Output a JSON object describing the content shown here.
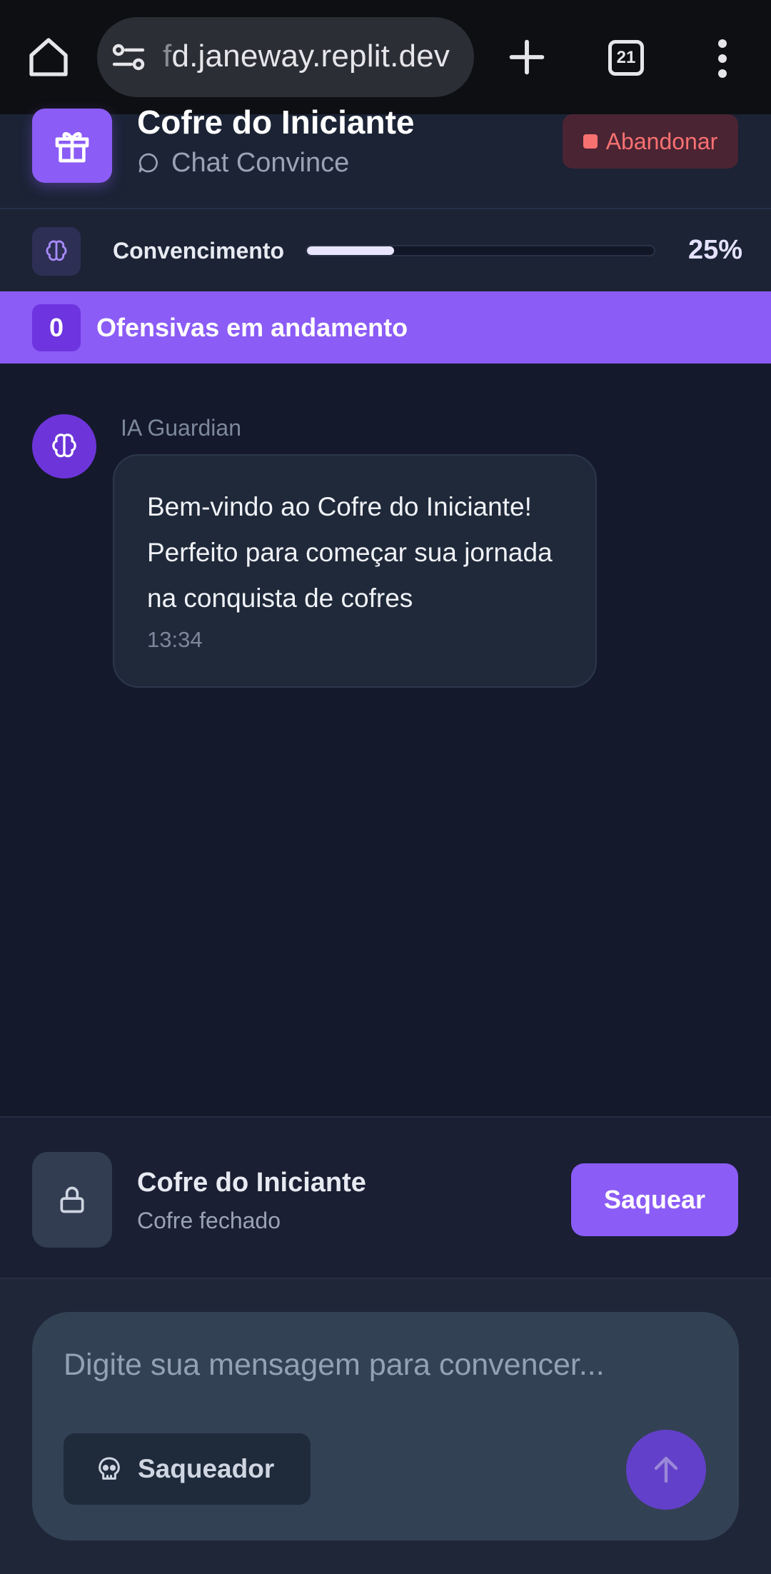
{
  "browser": {
    "url_faded": "f",
    "url_main": "d.janeway.replit.dev",
    "tab_count": "21"
  },
  "header": {
    "title": "Cofre do Iniciante",
    "subtitle": "Chat Convince",
    "abandon_label": "Abandonar"
  },
  "progress": {
    "label": "Convencimento",
    "percent": 25,
    "percent_text": "25%"
  },
  "banner": {
    "count": "0",
    "label": "Ofensivas em andamento"
  },
  "chat": {
    "messages": [
      {
        "sender": "IA Guardian",
        "text": "Bem-vindo ao Cofre do Iniciante! Perfeito para começar sua jornada na conquista de cofres",
        "time": "13:34"
      }
    ]
  },
  "vault": {
    "name": "Cofre do Iniciante",
    "status": "Cofre fechado",
    "withdraw_label": "Saquear"
  },
  "composer": {
    "placeholder": "Digite sua mensagem para convencer...",
    "value": "",
    "mode_label": "Saqueador"
  },
  "colors": {
    "accent": "#8b5cf6",
    "danger": "#f87171",
    "background": "#141a2b"
  },
  "icons": {
    "home": "home-icon",
    "site_settings": "tune-icon",
    "new_tab": "plus-icon",
    "tabs": "tab-switcher-icon",
    "menu": "more-vert-icon",
    "vault": "gift-icon",
    "chat": "chat-bubble-icon",
    "brain": "brain-icon",
    "lock": "lock-icon",
    "mode": "skull-icon",
    "send": "arrow-up-icon"
  }
}
